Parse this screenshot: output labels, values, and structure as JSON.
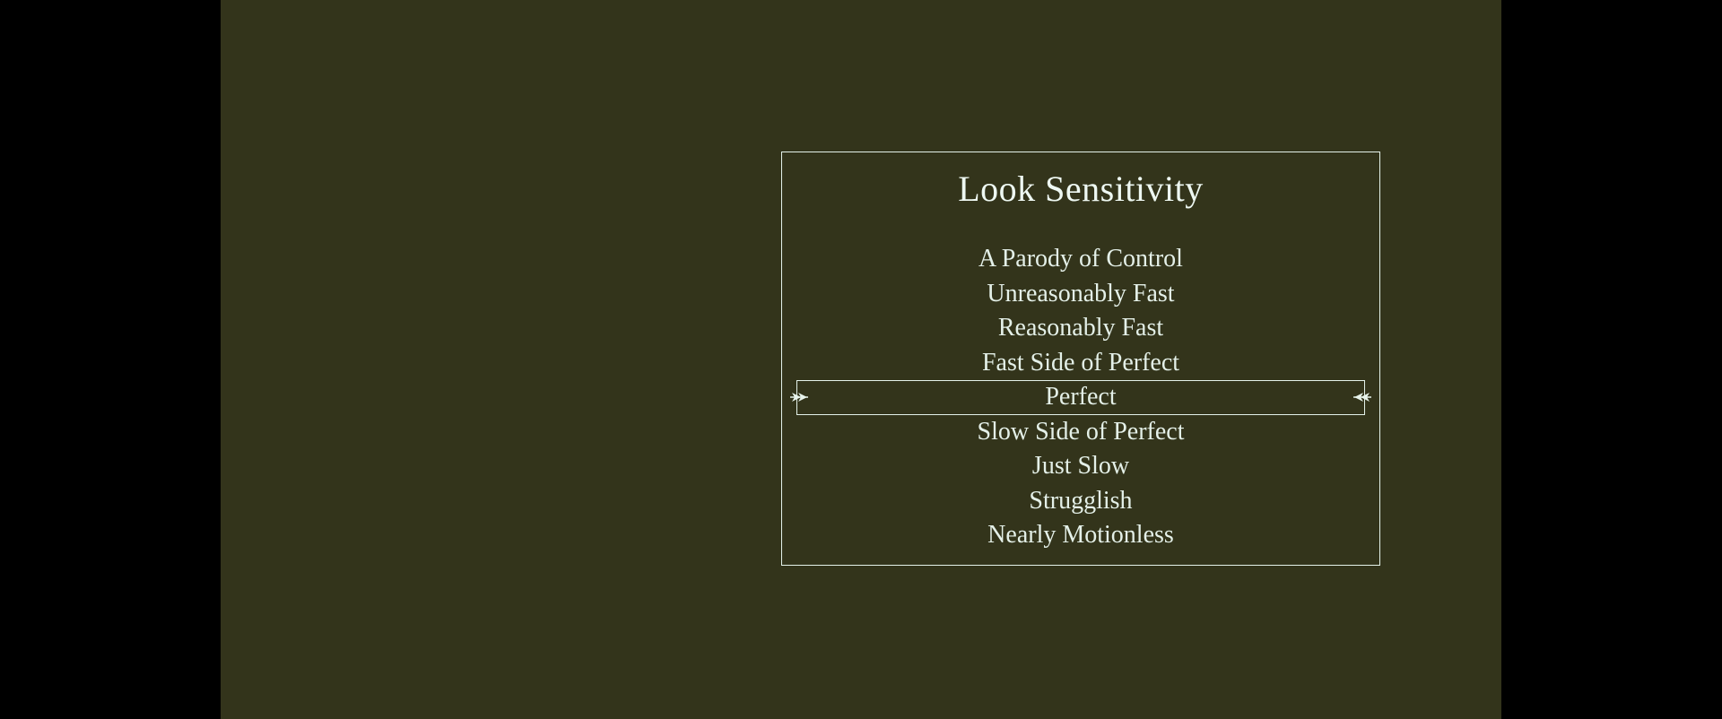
{
  "menu": {
    "title": "Look Sensitivity",
    "selected_index": 4,
    "options": [
      {
        "label": "A Parody of Control"
      },
      {
        "label": "Unreasonably Fast"
      },
      {
        "label": "Reasonably Fast"
      },
      {
        "label": "Fast Side of Perfect"
      },
      {
        "label": "Perfect"
      },
      {
        "label": "Slow Side of Perfect"
      },
      {
        "label": "Just Slow"
      },
      {
        "label": "Strugglish"
      },
      {
        "label": "Nearly Motionless"
      }
    ]
  },
  "colors": {
    "background": "#33341b",
    "letterbox": "#000000",
    "text": "#e8f4ec",
    "border": "#e4f2ea"
  },
  "icons": {
    "left": "arrow-right-icon",
    "right": "arrow-left-icon"
  }
}
